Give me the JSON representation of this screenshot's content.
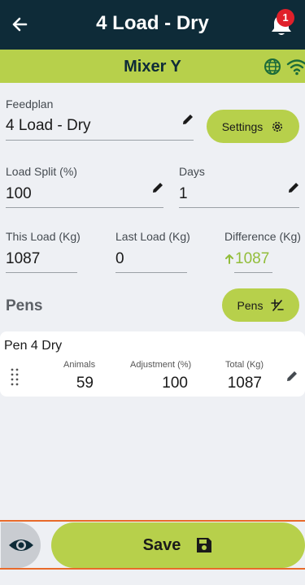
{
  "header": {
    "title": "4 Load - Dry",
    "notification_count": "1"
  },
  "subheader": {
    "title": "Mixer Y"
  },
  "feedplan": {
    "label": "Feedplan",
    "value": "4 Load - Dry",
    "settings_label": "Settings"
  },
  "load_split": {
    "label": "Load Split (%)",
    "value": "100"
  },
  "days": {
    "label": "Days",
    "value": "1"
  },
  "this_load": {
    "label": "This Load (Kg)",
    "value": "1087"
  },
  "last_load": {
    "label": "Last Load (Kg)",
    "value": "0"
  },
  "difference": {
    "label": "Difference (Kg)",
    "value": "1087"
  },
  "pens": {
    "title": "Pens",
    "button_label": "Pens",
    "items": [
      {
        "name": "Pen 4 Dry",
        "animals_label": "Animals",
        "animals": "59",
        "adjustment_label": "Adjustment (%)",
        "adjustment": "100",
        "total_label": "Total (Kg)",
        "total": "1087"
      }
    ]
  },
  "footer": {
    "save_label": "Save"
  },
  "colors": {
    "header_bg": "#0e2b38",
    "accent": "#b7d04b",
    "badge": "#e0202a",
    "positive": "#92bd3a",
    "highlight_border": "#e86a2a"
  },
  "icons": [
    "back-arrow-icon",
    "bell-icon",
    "globe-icon",
    "wifi-icon",
    "pencil-icon",
    "gear-icon",
    "plus-minus-icon",
    "drag-handle-icon",
    "eye-icon",
    "floppy-disk-icon",
    "arrow-up-icon"
  ]
}
